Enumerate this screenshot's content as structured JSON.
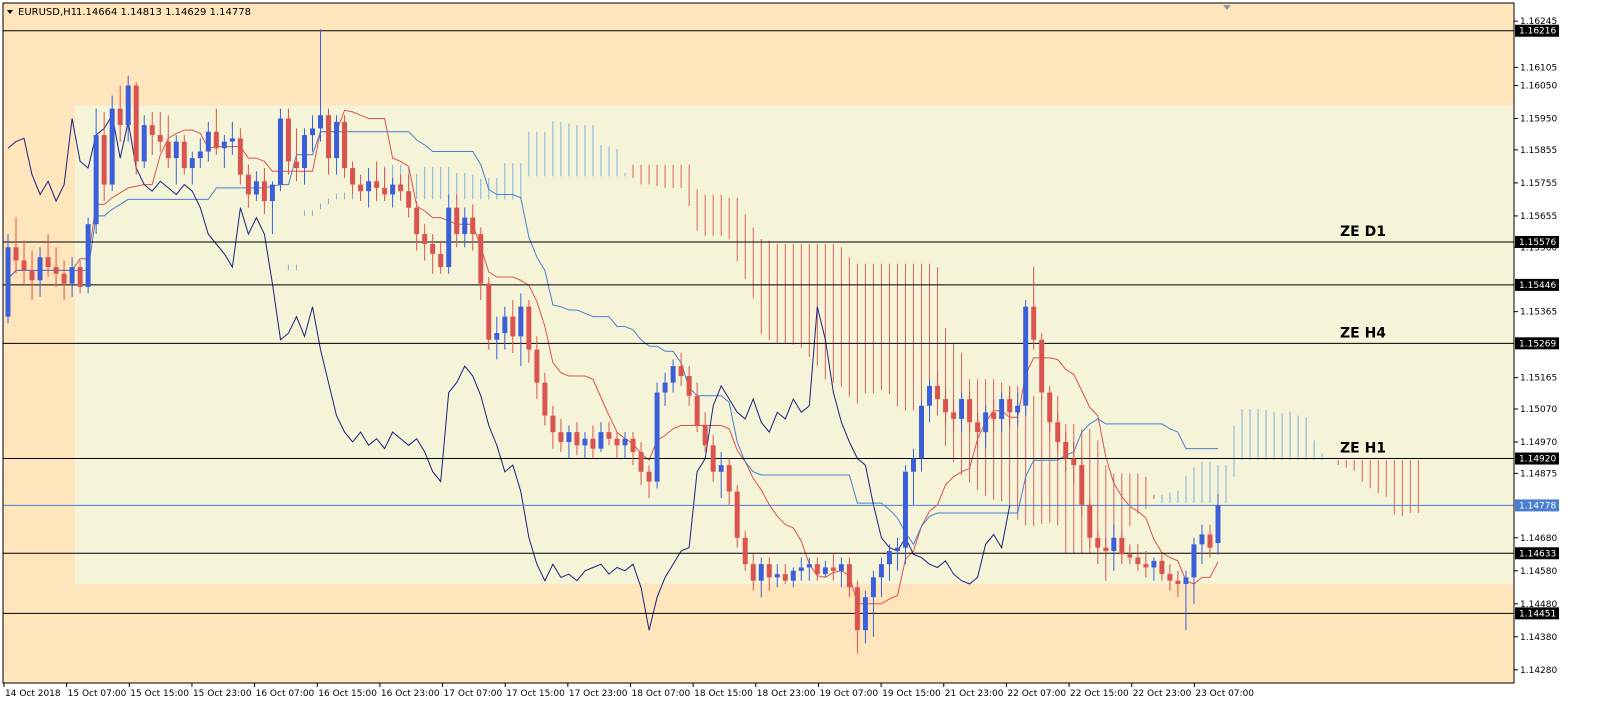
{
  "header": {
    "symbol_label": "EURUSD,H1",
    "quote": "1.14664 1.14813 1.14629 1.14778"
  },
  "chart_data": {
    "type": "candlestick",
    "symbol": "EURUSD",
    "timeframe": "H1",
    "ohlc_header": {
      "open": 1.14664,
      "high": 1.14813,
      "low": 1.14629,
      "close": 1.14778
    },
    "ylim": [
      1.1424,
      1.163
    ],
    "y_ticks": [
      1.16245,
      1.16105,
      1.1605,
      1.1595,
      1.15855,
      1.15755,
      1.15655,
      1.1556,
      1.15365,
      1.15165,
      1.1507,
      1.1497,
      1.14875,
      1.1468,
      1.1458,
      1.1448,
      1.1438,
      1.1428
    ],
    "x_ticks": [
      "14 Oct 2018",
      "15 Oct 07:00",
      "15 Oct 15:00",
      "15 Oct 23:00",
      "16 Oct 07:00",
      "16 Oct 15:00",
      "16 Oct 23:00",
      "17 Oct 07:00",
      "17 Oct 15:00",
      "17 Oct 23:00",
      "18 Oct 07:00",
      "18 Oct 15:00",
      "18 Oct 23:00",
      "19 Oct 07:00",
      "19 Oct 15:00",
      "21 Oct 23:00",
      "22 Oct 07:00",
      "22 Oct 15:00",
      "22 Oct 23:00",
      "23 Oct 07:00"
    ],
    "levels": [
      {
        "value": 1.16216,
        "label": "1.16216",
        "text": ""
      },
      {
        "value": 1.15576,
        "label": "1.15576",
        "text": "ZE D1"
      },
      {
        "value": 1.15446,
        "label": "1.15446",
        "text": ""
      },
      {
        "value": 1.15269,
        "label": "1.15269",
        "text": "ZE H4"
      },
      {
        "value": 1.1492,
        "label": "1.14920",
        "text": "ZE H1"
      },
      {
        "value": 1.14633,
        "label": "1.14633",
        "text": ""
      },
      {
        "value": 1.14451,
        "label": "1.14451",
        "text": ""
      }
    ],
    "current_price": {
      "value": 1.14778,
      "label": "1.14778"
    },
    "zones": [
      {
        "from": 1.1454,
        "to": 1.1599,
        "color": "#f5f3d8"
      }
    ],
    "ohlc": [
      [
        1.1535,
        1.156,
        1.1533,
        1.1556
      ],
      [
        1.1556,
        1.1565,
        1.1548,
        1.1552
      ],
      [
        1.1552,
        1.1558,
        1.1545,
        1.1549
      ],
      [
        1.1549,
        1.1555,
        1.154,
        1.1546
      ],
      [
        1.1546,
        1.1556,
        1.1541,
        1.1553
      ],
      [
        1.1553,
        1.156,
        1.1547,
        1.155
      ],
      [
        1.155,
        1.1556,
        1.1544,
        1.1548
      ],
      [
        1.1548,
        1.1552,
        1.154,
        1.1545
      ],
      [
        1.1545,
        1.1553,
        1.1541,
        1.155
      ],
      [
        1.155,
        1.1552,
        1.1542,
        1.1544
      ],
      [
        1.1544,
        1.1565,
        1.1542,
        1.1563
      ],
      [
        1.1563,
        1.1598,
        1.156,
        1.159
      ],
      [
        1.159,
        1.1597,
        1.157,
        1.1575
      ],
      [
        1.1575,
        1.1602,
        1.1573,
        1.1598
      ],
      [
        1.1598,
        1.1605,
        1.1588,
        1.1593
      ],
      [
        1.1593,
        1.1608,
        1.1588,
        1.1605
      ],
      [
        1.1605,
        1.1606,
        1.1578,
        1.1582
      ],
      [
        1.1582,
        1.1596,
        1.158,
        1.1593
      ],
      [
        1.1593,
        1.1597,
        1.1584,
        1.159
      ],
      [
        1.159,
        1.1597,
        1.1585,
        1.1588
      ],
      [
        1.1588,
        1.1596,
        1.158,
        1.1583
      ],
      [
        1.1583,
        1.159,
        1.1575,
        1.1588
      ],
      [
        1.1588,
        1.159,
        1.1578,
        1.158
      ],
      [
        1.158,
        1.1585,
        1.1575,
        1.1583
      ],
      [
        1.1583,
        1.1589,
        1.158,
        1.1585
      ],
      [
        1.1585,
        1.1594,
        1.1582,
        1.1591
      ],
      [
        1.1591,
        1.1598,
        1.1584,
        1.1586
      ],
      [
        1.1586,
        1.159,
        1.158,
        1.1588
      ],
      [
        1.1588,
        1.1594,
        1.1584,
        1.1589
      ],
      [
        1.1589,
        1.1592,
        1.1575,
        1.1578
      ],
      [
        1.1578,
        1.1581,
        1.1568,
        1.1572
      ],
      [
        1.1572,
        1.1579,
        1.157,
        1.1576
      ],
      [
        1.1576,
        1.158,
        1.1566,
        1.157
      ],
      [
        1.157,
        1.1576,
        1.156,
        1.1575
      ],
      [
        1.1575,
        1.1598,
        1.1573,
        1.1595
      ],
      [
        1.1595,
        1.1598,
        1.1578,
        1.1582
      ],
      [
        1.1582,
        1.1592,
        1.1576,
        1.158
      ],
      [
        1.158,
        1.1592,
        1.1575,
        1.159
      ],
      [
        1.159,
        1.1596,
        1.1585,
        1.1592
      ],
      [
        1.1592,
        1.1622,
        1.1588,
        1.1596
      ],
      [
        1.1596,
        1.1598,
        1.1578,
        1.1583
      ],
      [
        1.1583,
        1.1596,
        1.1578,
        1.1594
      ],
      [
        1.1594,
        1.1596,
        1.1577,
        1.158
      ],
      [
        1.158,
        1.1582,
        1.1572,
        1.1575
      ],
      [
        1.1575,
        1.1578,
        1.157,
        1.1573
      ],
      [
        1.1573,
        1.158,
        1.1568,
        1.1576
      ],
      [
        1.1576,
        1.1582,
        1.157,
        1.1574
      ],
      [
        1.1574,
        1.158,
        1.157,
        1.1572
      ],
      [
        1.1572,
        1.1577,
        1.1568,
        1.1575
      ],
      [
        1.1575,
        1.1578,
        1.157,
        1.1573
      ],
      [
        1.1573,
        1.1578,
        1.1565,
        1.1568
      ],
      [
        1.1568,
        1.157,
        1.1555,
        1.156
      ],
      [
        1.156,
        1.1563,
        1.1552,
        1.1557
      ],
      [
        1.1557,
        1.156,
        1.1548,
        1.1554
      ],
      [
        1.1554,
        1.1558,
        1.1548,
        1.155
      ],
      [
        1.155,
        1.1572,
        1.1548,
        1.1568
      ],
      [
        1.1568,
        1.1572,
        1.1556,
        1.156
      ],
      [
        1.156,
        1.1568,
        1.1556,
        1.1565
      ],
      [
        1.1565,
        1.1569,
        1.1555,
        1.156
      ],
      [
        1.156,
        1.1562,
        1.154,
        1.1545
      ],
      [
        1.1545,
        1.1547,
        1.1525,
        1.1528
      ],
      [
        1.1528,
        1.1535,
        1.1522,
        1.153
      ],
      [
        1.153,
        1.1538,
        1.1525,
        1.1535
      ],
      [
        1.1535,
        1.154,
        1.1524,
        1.1529
      ],
      [
        1.1529,
        1.1542,
        1.152,
        1.1538
      ],
      [
        1.1538,
        1.154,
        1.1521,
        1.1525
      ],
      [
        1.1525,
        1.1529,
        1.151,
        1.1515
      ],
      [
        1.1515,
        1.1518,
        1.1502,
        1.1505
      ],
      [
        1.1505,
        1.1508,
        1.1495,
        1.15
      ],
      [
        1.15,
        1.1504,
        1.1494,
        1.1497
      ],
      [
        1.1497,
        1.1502,
        1.1492,
        1.15
      ],
      [
        1.15,
        1.1503,
        1.1493,
        1.1496
      ],
      [
        1.1496,
        1.15,
        1.1492,
        1.1498
      ],
      [
        1.1498,
        1.1502,
        1.1492,
        1.1495
      ],
      [
        1.1495,
        1.1503,
        1.1494,
        1.15
      ],
      [
        1.15,
        1.1503,
        1.1496,
        1.1498
      ],
      [
        1.1498,
        1.15,
        1.1492,
        1.1496
      ],
      [
        1.1496,
        1.15,
        1.1492,
        1.1498
      ],
      [
        1.1498,
        1.15,
        1.149,
        1.1494
      ],
      [
        1.1494,
        1.1497,
        1.1484,
        1.1488
      ],
      [
        1.1488,
        1.149,
        1.148,
        1.1485
      ],
      [
        1.1485,
        1.1515,
        1.1483,
        1.1512
      ],
      [
        1.1512,
        1.1518,
        1.1508,
        1.1515
      ],
      [
        1.1515,
        1.1522,
        1.1512,
        1.152
      ],
      [
        1.152,
        1.1524,
        1.1514,
        1.1517
      ],
      [
        1.1517,
        1.152,
        1.1508,
        1.1511
      ],
      [
        1.1511,
        1.1515,
        1.15,
        1.1502
      ],
      [
        1.1502,
        1.1506,
        1.1494,
        1.1496
      ],
      [
        1.1496,
        1.1499,
        1.1485,
        1.1488
      ],
      [
        1.1488,
        1.1494,
        1.148,
        1.149
      ],
      [
        1.149,
        1.1492,
        1.1478,
        1.1482
      ],
      [
        1.1482,
        1.1484,
        1.1465,
        1.1468
      ],
      [
        1.1468,
        1.147,
        1.1458,
        1.146
      ],
      [
        1.146,
        1.1463,
        1.1452,
        1.1455
      ],
      [
        1.1455,
        1.1462,
        1.145,
        1.146
      ],
      [
        1.146,
        1.1462,
        1.1452,
        1.1456
      ],
      [
        1.1456,
        1.146,
        1.1453,
        1.1457
      ],
      [
        1.1457,
        1.146,
        1.1454,
        1.1455
      ],
      [
        1.1455,
        1.1459,
        1.1453,
        1.1458
      ],
      [
        1.1458,
        1.1462,
        1.1455,
        1.1459
      ],
      [
        1.1459,
        1.1462,
        1.1455,
        1.146
      ],
      [
        1.146,
        1.1462,
        1.1455,
        1.1457
      ],
      [
        1.1457,
        1.1461,
        1.1456,
        1.1459
      ],
      [
        1.1459,
        1.1463,
        1.1455,
        1.1458
      ],
      [
        1.1458,
        1.1462,
        1.1453,
        1.146
      ],
      [
        1.146,
        1.1462,
        1.145,
        1.1453
      ],
      [
        1.1453,
        1.1455,
        1.1433,
        1.144
      ],
      [
        1.144,
        1.1452,
        1.1436,
        1.145
      ],
      [
        1.145,
        1.1458,
        1.1438,
        1.1456
      ],
      [
        1.1456,
        1.1462,
        1.145,
        1.146
      ],
      [
        1.146,
        1.1466,
        1.1455,
        1.1464
      ],
      [
        1.1464,
        1.1468,
        1.1458,
        1.1465
      ],
      [
        1.1465,
        1.149,
        1.146,
        1.1488
      ],
      [
        1.1488,
        1.1495,
        1.1478,
        1.1492
      ],
      [
        1.1492,
        1.151,
        1.1488,
        1.1508
      ],
      [
        1.1508,
        1.1516,
        1.1503,
        1.1514
      ],
      [
        1.1514,
        1.1518,
        1.1508,
        1.151
      ],
      [
        1.151,
        1.1513,
        1.1502,
        1.1506
      ],
      [
        1.1506,
        1.151,
        1.15,
        1.1504
      ],
      [
        1.1504,
        1.1512,
        1.15,
        1.151
      ],
      [
        1.151,
        1.1512,
        1.15,
        1.1503
      ],
      [
        1.1503,
        1.1506,
        1.1495,
        1.15
      ],
      [
        1.15,
        1.1508,
        1.1495,
        1.1506
      ],
      [
        1.1506,
        1.151,
        1.15,
        1.1504
      ],
      [
        1.1504,
        1.1512,
        1.15,
        1.151
      ],
      [
        1.151,
        1.1514,
        1.1502,
        1.1506
      ],
      [
        1.1506,
        1.1512,
        1.1502,
        1.1508
      ],
      [
        1.1508,
        1.154,
        1.1505,
        1.1538
      ],
      [
        1.1538,
        1.155,
        1.1525,
        1.1528
      ],
      [
        1.1528,
        1.153,
        1.151,
        1.1512
      ],
      [
        1.1512,
        1.1514,
        1.15,
        1.1503
      ],
      [
        1.1503,
        1.1506,
        1.1494,
        1.1497
      ],
      [
        1.1497,
        1.15,
        1.1488,
        1.1492
      ],
      [
        1.1492,
        1.1497,
        1.1485,
        1.149
      ],
      [
        1.149,
        1.1493,
        1.1475,
        1.1478
      ],
      [
        1.1478,
        1.148,
        1.1465,
        1.1468
      ],
      [
        1.1468,
        1.147,
        1.146,
        1.1465
      ],
      [
        1.1465,
        1.1468,
        1.1455,
        1.1464
      ],
      [
        1.1464,
        1.1472,
        1.1458,
        1.1468
      ],
      [
        1.1468,
        1.147,
        1.146,
        1.1463
      ],
      [
        1.1463,
        1.1466,
        1.146,
        1.1462
      ],
      [
        1.1462,
        1.1466,
        1.1458,
        1.146
      ],
      [
        1.146,
        1.1464,
        1.1456,
        1.1459
      ],
      [
        1.1459,
        1.1462,
        1.1455,
        1.1461
      ],
      [
        1.1461,
        1.1463,
        1.1455,
        1.1457
      ],
      [
        1.1457,
        1.146,
        1.1452,
        1.1455
      ],
      [
        1.1455,
        1.1458,
        1.145,
        1.1454
      ],
      [
        1.1454,
        1.1458,
        1.144,
        1.1456
      ],
      [
        1.1456,
        1.1468,
        1.1448,
        1.1466
      ],
      [
        1.1466,
        1.1472,
        1.146,
        1.1469
      ],
      [
        1.1469,
        1.1472,
        1.1462,
        1.1465
      ],
      [
        1.14664,
        1.14813,
        1.14629,
        1.14778
      ]
    ]
  }
}
